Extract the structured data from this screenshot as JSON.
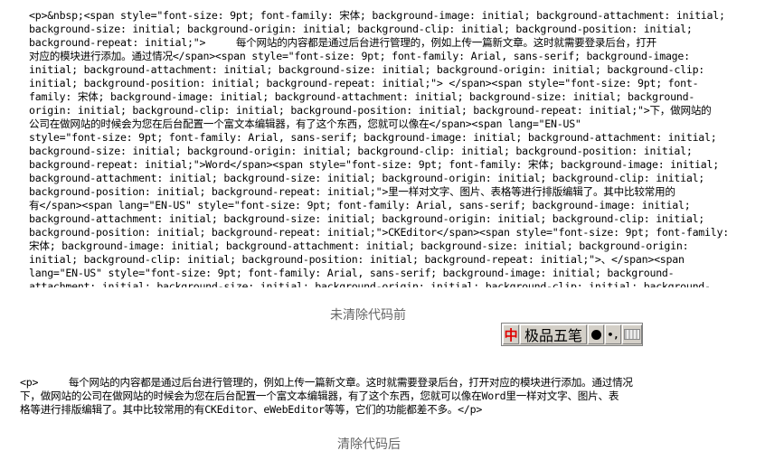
{
  "before_code": {
    "lines": [
      "<p>&nbsp;<span style=\"font-size: 9pt; font-family: 宋体; background-image: initial; background-attachment: initial;",
      "background-size: initial; background-origin: initial; background-clip: initial; background-position: initial;",
      "background-repeat: initial;\">     每个网站的内容都是通过后台进行管理的，例如上传一篇新文章。这时就需要登录后台，打开",
      "对应的模块进行添加。通过情况</span><span style=\"font-size: 9pt; font-family: Arial, sans-serif; background-image:",
      "initial; background-attachment: initial; background-size: initial; background-origin: initial; background-clip:",
      "initial; background-position: initial; background-repeat: initial;\"> </span><span style=\"font-size: 9pt; font-",
      "family: 宋体; background-image: initial; background-attachment: initial; background-size: initial; background-",
      "origin: initial; background-clip: initial; background-position: initial; background-repeat: initial;\">下，做网站的",
      "公司在做网站的时候会为您在后台配置一个富文本编辑器，有了这个东西，您就可以像在</span><span lang=\"EN-US\"",
      "style=\"font-size: 9pt; font-family: Arial, sans-serif; background-image: initial; background-attachment: initial;",
      "background-size: initial; background-origin: initial; background-clip: initial; background-position: initial;",
      "background-repeat: initial;\">Word</span><span style=\"font-size: 9pt; font-family: 宋体; background-image: initial;",
      "background-attachment: initial; background-size: initial; background-origin: initial; background-clip: initial;",
      "background-position: initial; background-repeat: initial;\">里一样对文字、图片、表格等进行排版编辑了。其中比较常用的",
      "有</span><span lang=\"EN-US\" style=\"font-size: 9pt; font-family: Arial, sans-serif; background-image: initial;",
      "background-attachment: initial; background-size: initial; background-origin: initial; background-clip: initial;",
      "background-position: initial; background-repeat: initial;\">CKEditor</span><span style=\"font-size: 9pt; font-family:",
      "宋体; background-image: initial; background-attachment: initial; background-size: initial; background-origin:",
      "initial; background-clip: initial; background-position: initial; background-repeat: initial;\">、</span><span",
      "lang=\"EN-US\" style=\"font-size: 9pt; font-family: Arial, sans-serif; background-image: initial; background-",
      "attachment: initial; background-size: initial; background-origin: initial; background-clip: initial; background-"
    ]
  },
  "captions": {
    "before": "未清除代码前",
    "after": "清除代码后"
  },
  "ime_toolbar": {
    "logo": "中",
    "name": "极品五笔",
    "punct": "•,"
  },
  "after_code": {
    "lines": [
      "<p>     每个网站的内容都是通过后台进行管理的，例如上传一篇新文章。这时就需要登录后台，打开对应的模块进行添加。通过情况",
      "下，做网站的公司在做网站的时候会为您在后台配置一个富文本编辑器，有了这个东西，您就可以像在Word里一样对文字、图片、表",
      "格等进行排版编辑了。其中比较常用的有CKEditor、eWebEditor等等，它们的功能都差不多。</p>"
    ]
  }
}
